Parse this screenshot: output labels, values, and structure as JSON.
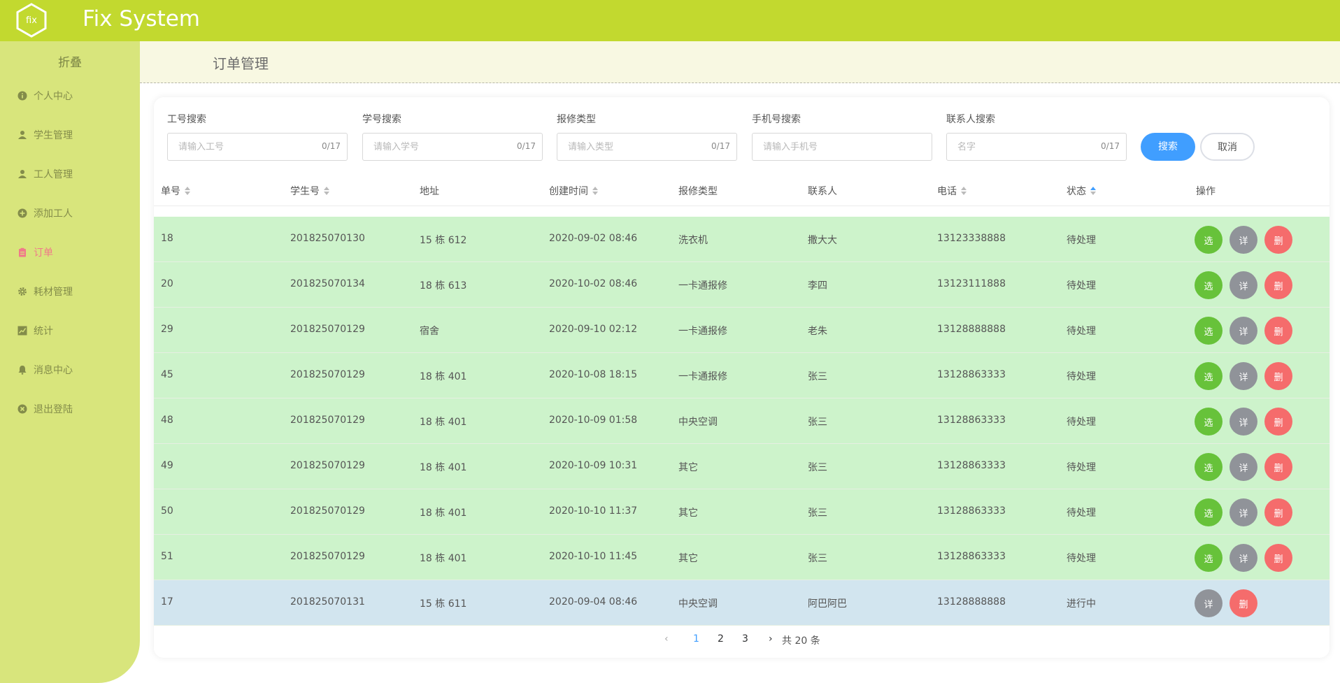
{
  "app": {
    "logo_text": "fix",
    "title": "Fix System"
  },
  "sidebar": {
    "collapse_label": "折叠",
    "items": [
      {
        "label": "个人中心",
        "icon": "info-icon"
      },
      {
        "label": "学生管理",
        "icon": "user-icon"
      },
      {
        "label": "工人管理",
        "icon": "user-icon"
      },
      {
        "label": "添加工人",
        "icon": "plus-circle-icon"
      },
      {
        "label": "订单",
        "icon": "clipboard-icon",
        "active": true
      },
      {
        "label": "耗材管理",
        "icon": "gear-icon"
      },
      {
        "label": "统计",
        "icon": "chart-icon"
      },
      {
        "label": "消息中心",
        "icon": "bell-icon"
      },
      {
        "label": "退出登陆",
        "icon": "close-circle-icon"
      }
    ]
  },
  "page": {
    "title": "订单管理"
  },
  "search": {
    "fields": [
      {
        "label": "工号搜索",
        "placeholder": "请输入工号",
        "count": "0/17"
      },
      {
        "label": "学号搜索",
        "placeholder": "请输入学号",
        "count": "0/17"
      },
      {
        "label": "报修类型",
        "placeholder": "请输入类型",
        "count": "0/17"
      },
      {
        "label": "手机号搜索",
        "placeholder": "请输入手机号",
        "count": ""
      },
      {
        "label": "联系人搜索",
        "placeholder": "名字",
        "count": "0/17"
      }
    ],
    "search_label": "搜索",
    "cancel_label": "取消"
  },
  "table": {
    "headers": [
      "单号",
      "学生号",
      "地址",
      "创建时间",
      "报修类型",
      "联系人",
      "电话",
      "状态",
      "操作"
    ],
    "rows": [
      {
        "id": "18",
        "student": "201825070130",
        "addr": "15 栋 612",
        "time": "2020-09-02 08:46",
        "type": "洗衣机",
        "contact": "撒大大",
        "phone": "13123338888",
        "status": "待处理"
      },
      {
        "id": "20",
        "student": "201825070134",
        "addr": "18 栋 613",
        "time": "2020-10-02 08:46",
        "type": "一卡通报修",
        "contact": "李四",
        "phone": "13123111888",
        "status": "待处理"
      },
      {
        "id": "29",
        "student": "201825070129",
        "addr": "宿舍",
        "time": "2020-09-10 02:12",
        "type": "一卡通报修",
        "contact": "老朱",
        "phone": "13128888888",
        "status": "待处理"
      },
      {
        "id": "45",
        "student": "201825070129",
        "addr": "18 栋 401",
        "time": "2020-10-08 18:15",
        "type": "一卡通报修",
        "contact": "张三",
        "phone": "13128863333",
        "status": "待处理"
      },
      {
        "id": "48",
        "student": "201825070129",
        "addr": "18 栋 401",
        "time": "2020-10-09 01:58",
        "type": "中央空调",
        "contact": "张三",
        "phone": "13128863333",
        "status": "待处理"
      },
      {
        "id": "49",
        "student": "201825070129",
        "addr": "18 栋 401",
        "time": "2020-10-09 10:31",
        "type": "其它",
        "contact": "张三",
        "phone": "13128863333",
        "status": "待处理"
      },
      {
        "id": "50",
        "student": "201825070129",
        "addr": "18 栋 401",
        "time": "2020-10-10 11:37",
        "type": "其它",
        "contact": "张三",
        "phone": "13128863333",
        "status": "待处理"
      },
      {
        "id": "51",
        "student": "201825070129",
        "addr": "18 栋 401",
        "time": "2020-10-10 11:45",
        "type": "其它",
        "contact": "张三",
        "phone": "13128863333",
        "status": "待处理"
      },
      {
        "id": "17",
        "student": "201825070131",
        "addr": "15 栋 611",
        "time": "2020-09-04 08:46",
        "type": "中央空调",
        "contact": "阿巴阿巴",
        "phone": "13128888888",
        "status": "进行中"
      }
    ],
    "actions": {
      "select": "选",
      "detail": "详",
      "delete": "删"
    }
  },
  "pagination": {
    "pages": [
      "1",
      "2",
      "3"
    ],
    "current": "1",
    "total": "共 20 条"
  },
  "colors": {
    "header": "#c2d92f",
    "sidebar": "#d8e57c",
    "pending_row": "#cdf3cb",
    "progress_row": "#d2e5ef",
    "primary": "#409eff",
    "success": "#67c23a",
    "danger": "#f56c6c",
    "info": "#909399"
  }
}
